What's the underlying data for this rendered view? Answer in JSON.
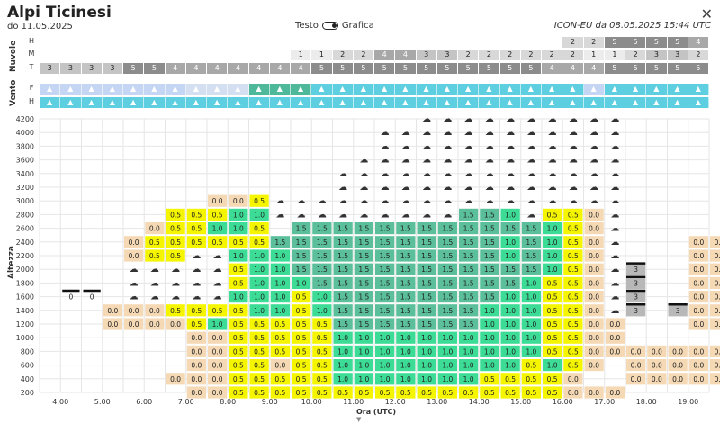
{
  "header": {
    "title": "Alpi Ticinesi",
    "subtitle": "do 11.05.2025",
    "toggle_left": "Testo",
    "toggle_right": "Grafica",
    "source": "ICON-EU da 08.05.2025 15:44 UTC",
    "close_icon": "close-icon"
  },
  "clouds": {
    "section_label": "Nuvole",
    "rows": [
      {
        "label": "H",
        "values": [
          "",
          "",
          "",
          "",
          "",
          "",
          "",
          "",
          "",
          "",
          "",
          "",
          "",
          "",
          "",
          "",
          "",
          "",
          "",
          "",
          "",
          "",
          "",
          "",
          "",
          "2",
          "2",
          "5",
          "5",
          "5",
          "5",
          "4"
        ]
      },
      {
        "label": "M",
        "values": [
          "",
          "",
          "",
          "",
          "",
          "",
          "",
          "",
          "",
          "",
          "",
          "",
          "1",
          "1",
          "2",
          "2",
          "4",
          "4",
          "3",
          "3",
          "2",
          "2",
          "2",
          "2",
          "2",
          "2",
          "1",
          "1",
          "2",
          "3",
          "3",
          "2"
        ]
      },
      {
        "label": "T",
        "values": [
          "3",
          "3",
          "3",
          "3",
          "5",
          "5",
          "4",
          "4",
          "4",
          "4",
          "4",
          "4",
          "4",
          "5",
          "5",
          "5",
          "5",
          "5",
          "5",
          "5",
          "5",
          "5",
          "5",
          "5",
          "4",
          "4",
          "4",
          "5",
          "5",
          "5",
          "5",
          "5"
        ]
      }
    ]
  },
  "wind": {
    "section_label": "Vento",
    "rows": [
      {
        "label": "F",
        "colors": [
          "#c4d6f4",
          "#c4d6f4",
          "#c4d6f4",
          "#c4d6f4",
          "#c4d6f4",
          "#c4d6f4",
          "#c4d6f4",
          "#d4dff2",
          "#d4dff2",
          "#d4dff2",
          "#4db89a",
          "#4db89a",
          "#4db89a",
          "#5dcfe0",
          "#5dcfe0",
          "#5dcfe0",
          "#5dcfe0",
          "#5dcfe0",
          "#5dcfe0",
          "#5dcfe0",
          "#5dcfe0",
          "#5dcfe0",
          "#5dcfe0",
          "#5dcfe0",
          "#5dcfe0",
          "#5dcfe0",
          "#c4d6f4",
          "#5dcfe0",
          "#5dcfe0",
          "#5dcfe0",
          "#5dcfe0",
          "#5dcfe0"
        ]
      },
      {
        "label": "H",
        "colors": [
          "#5dcfe0",
          "#5dcfe0",
          "#5dcfe0",
          "#5dcfe0",
          "#5dcfe0",
          "#5dcfe0",
          "#5dcfe0",
          "#5dcfe0",
          "#5dcfe0",
          "#5dcfe0",
          "#5dcfe0",
          "#5dcfe0",
          "#5dcfe0",
          "#5dcfe0",
          "#5dcfe0",
          "#5dcfe0",
          "#5dcfe0",
          "#5dcfe0",
          "#5dcfe0",
          "#5dcfe0",
          "#5dcfe0",
          "#5dcfe0",
          "#5dcfe0",
          "#5dcfe0",
          "#5dcfe0",
          "#5dcfe0",
          "#5dcfe0",
          "#5dcfe0",
          "#5dcfe0",
          "#5dcfe0",
          "#5dcfe0",
          "#5dcfe0"
        ]
      }
    ]
  },
  "chart_data": {
    "type": "heatmap",
    "xlabel": "Ora (UTC)",
    "ylabel": "Altezza",
    "x_ticks": [
      "4:00",
      "5:00",
      "6:00",
      "7:00",
      "8:00",
      "9:00",
      "10:00",
      "11:00",
      "12:00",
      "13:00",
      "14:00",
      "15:00",
      "16:00",
      "17:00",
      "18:00",
      "19:00"
    ],
    "y_ticks": [
      4200,
      4000,
      3800,
      3600,
      3400,
      3200,
      3000,
      2800,
      2600,
      2400,
      2200,
      2000,
      1800,
      1600,
      1400,
      1200,
      1000,
      800,
      600,
      400,
      200
    ],
    "colors": {
      "0.0": "#f5d9b5",
      "0.5": "#f5f500",
      "1.0": "#3cdc96",
      "1.5": "#5abf9a",
      "3": "#b8b8b8",
      "cloud": "none"
    },
    "grid": [
      {
        "altitude": 3000,
        "cells": {
          "8": "0.0",
          "9": "0.0",
          "10": "0.5"
        }
      },
      {
        "altitude": 2800,
        "cells": {
          "6": "0.5",
          "7": "0.5",
          "8": "0.5",
          "9": "1.0",
          "10": "1.0",
          "20": "1.5",
          "21": "1.5",
          "22": "1.0",
          "24": "0.5",
          "25": "0.5",
          "26": "0.0"
        }
      },
      {
        "altitude": 2600,
        "cells": {
          "5": "0.0",
          "6": "0.5",
          "7": "0.5",
          "8": "1.0",
          "9": "1.0",
          "10": "0.5",
          "12": "1.5",
          "13": "1.5",
          "14": "1.5",
          "15": "1.5",
          "16": "1.5",
          "17": "1.5",
          "18": "1.5",
          "19": "1.5",
          "20": "1.5",
          "21": "1.5",
          "22": "1.5",
          "23": "1.5",
          "24": "1.0",
          "25": "0.5",
          "26": "0.0"
        }
      },
      {
        "altitude": 2400,
        "cells": {
          "4": "0.0",
          "5": "0.5",
          "6": "0.5",
          "7": "0.5",
          "8": "0.5",
          "9": "0.5",
          "10": "0.5",
          "11": "1.5",
          "12": "1.5",
          "13": "1.5",
          "14": "1.5",
          "15": "1.5",
          "16": "1.5",
          "17": "1.5",
          "18": "1.5",
          "19": "1.5",
          "20": "1.5",
          "21": "1.5",
          "22": "1.0",
          "23": "1.5",
          "24": "1.0",
          "25": "0.5",
          "26": "0.0",
          "31": "0.0",
          "32": "0.0"
        }
      },
      {
        "altitude": 2200,
        "cells": {
          "4": "0.0",
          "5": "0.5",
          "6": "0.5",
          "9": "1.0",
          "10": "1.0",
          "11": "1.0",
          "12": "1.5",
          "13": "1.5",
          "14": "1.5",
          "15": "1.5",
          "16": "1.5",
          "17": "1.5",
          "18": "1.5",
          "19": "1.5",
          "20": "1.5",
          "21": "1.5",
          "22": "1.0",
          "23": "1.5",
          "24": "1.0",
          "25": "0.5",
          "26": "0.0",
          "31": "0.0",
          "32": "0.0"
        }
      },
      {
        "altitude": 2000,
        "cells": {
          "9": "0.5",
          "10": "1.0",
          "11": "1.0",
          "12": "1.5",
          "13": "1.5",
          "14": "1.5",
          "15": "1.5",
          "16": "1.5",
          "17": "1.5",
          "18": "1.5",
          "19": "1.5",
          "20": "1.5",
          "21": "1.5",
          "22": "1.5",
          "23": "1.5",
          "24": "1.0",
          "25": "0.5",
          "26": "0.0",
          "28": "3",
          "31": "0.0",
          "32": "0.0"
        }
      },
      {
        "altitude": 1800,
        "cells": {
          "9": "0.5",
          "10": "1.0",
          "11": "1.0",
          "12": "1.0",
          "13": "1.5",
          "14": "1.5",
          "15": "1.5",
          "16": "1.5",
          "17": "1.5",
          "18": "1.5",
          "19": "1.5",
          "20": "1.5",
          "21": "1.5",
          "22": "1.5",
          "23": "1.0",
          "24": "0.5",
          "25": "0.5",
          "26": "0.0",
          "28": "3",
          "31": "0.0",
          "32": "0.0"
        }
      },
      {
        "altitude": 1600,
        "cells": {
          "1": "0",
          "2": "0",
          "9": "1.0",
          "10": "1.0",
          "11": "1.0",
          "12": "0.5",
          "13": "1.0",
          "14": "1.5",
          "15": "1.5",
          "16": "1.5",
          "17": "1.5",
          "18": "1.5",
          "19": "1.5",
          "20": "1.5",
          "21": "1.5",
          "22": "1.0",
          "23": "1.0",
          "24": "0.5",
          "25": "0.5",
          "26": "0.0",
          "28": "3",
          "31": "0.0",
          "32": "0.0"
        }
      },
      {
        "altitude": 1400,
        "cells": {
          "3": "0.0",
          "4": "0.0",
          "5": "0.0",
          "6": "0.5",
          "7": "0.5",
          "8": "0.5",
          "9": "0.5",
          "10": "1.0",
          "11": "1.0",
          "12": "0.5",
          "13": "1.0",
          "14": "1.5",
          "15": "1.5",
          "16": "1.5",
          "17": "1.5",
          "18": "1.5",
          "19": "1.5",
          "20": "1.5",
          "21": "1.0",
          "22": "1.0",
          "23": "1.0",
          "24": "0.5",
          "25": "0.5",
          "26": "0.0",
          "28": "3",
          "30": "3",
          "31": "0.0",
          "32": "0.0"
        }
      },
      {
        "altitude": 1200,
        "cells": {
          "3": "0.0",
          "4": "0.0",
          "5": "0.0",
          "6": "0.0",
          "7": "0.5",
          "8": "1.0",
          "9": "0.5",
          "10": "0.5",
          "11": "0.5",
          "12": "0.5",
          "13": "0.5",
          "14": "1.5",
          "15": "1.5",
          "16": "1.5",
          "17": "1.5",
          "18": "1.5",
          "19": "1.5",
          "20": "1.5",
          "21": "1.0",
          "22": "1.0",
          "23": "1.0",
          "24": "0.5",
          "25": "0.5",
          "26": "0.0",
          "27": "0.0",
          "31": "0.0",
          "32": "0.0"
        }
      },
      {
        "altitude": 1000,
        "cells": {
          "7": "0.0",
          "8": "0.0",
          "9": "0.5",
          "10": "0.5",
          "11": "0.5",
          "12": "0.5",
          "13": "0.5",
          "14": "1.0",
          "15": "1.0",
          "16": "1.0",
          "17": "1.0",
          "18": "1.0",
          "19": "1.0",
          "20": "1.0",
          "21": "1.0",
          "22": "1.0",
          "23": "1.0",
          "24": "0.5",
          "25": "0.5",
          "26": "0.0",
          "27": "0.0"
        }
      },
      {
        "altitude": 800,
        "cells": {
          "7": "0.0",
          "8": "0.0",
          "9": "0.5",
          "10": "0.5",
          "11": "0.5",
          "12": "0.5",
          "13": "0.5",
          "14": "1.0",
          "15": "1.0",
          "16": "1.0",
          "17": "1.0",
          "18": "1.0",
          "19": "1.0",
          "20": "1.0",
          "21": "1.0",
          "22": "1.0",
          "23": "1.0",
          "24": "0.5",
          "25": "0.5",
          "26": "0.0",
          "27": "0.0",
          "28": "0.0",
          "29": "0.0",
          "30": "0.0",
          "31": "0.0",
          "32": "0.0"
        }
      },
      {
        "altitude": 600,
        "cells": {
          "7": "0.0",
          "8": "0.0",
          "9": "0.5",
          "10": "0.5",
          "11": "0.0",
          "12": "0.5",
          "13": "0.5",
          "14": "1.0",
          "15": "1.0",
          "16": "1.0",
          "17": "1.0",
          "18": "1.0",
          "19": "1.0",
          "20": "1.0",
          "21": "1.0",
          "22": "1.0",
          "23": "0.5",
          "24": "1.0",
          "25": "0.5",
          "26": "0.0",
          "28": "0.0",
          "29": "0.0",
          "30": "0.0",
          "31": "0.0",
          "32": "0.0"
        }
      },
      {
        "altitude": 400,
        "cells": {
          "6": "0.0",
          "7": "0.0",
          "8": "0.0",
          "9": "0.5",
          "10": "0.5",
          "11": "0.5",
          "12": "0.5",
          "13": "0.5",
          "14": "1.0",
          "15": "1.0",
          "16": "1.0",
          "17": "1.0",
          "18": "1.0",
          "19": "1.0",
          "20": "1.0",
          "21": "0.5",
          "22": "0.5",
          "23": "0.5",
          "24": "0.5",
          "25": "0.0",
          "28": "0.0",
          "29": "0.0",
          "30": "0.0",
          "31": "0.0",
          "32": "0.0"
        }
      },
      {
        "altitude": 200,
        "cells": {
          "7": "0.0",
          "8": "0.0",
          "9": "0.5",
          "10": "0.5",
          "11": "0.5",
          "12": "0.5",
          "13": "0.5",
          "14": "0.5",
          "15": "0.5",
          "16": "0.5",
          "17": "0.5",
          "18": "0.5",
          "19": "0.5",
          "20": "0.5",
          "21": "0.5",
          "22": "0.5",
          "23": "0.5",
          "24": "0.5",
          "25": "0.0",
          "26": "0.0",
          "27": "0.0"
        }
      }
    ]
  }
}
